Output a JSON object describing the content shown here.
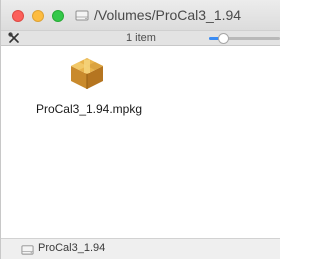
{
  "window": {
    "title": "/Volumes/ProCal3_1.94",
    "title_icon": "disk-icon"
  },
  "statusbar": {
    "tools_icon": "tools-icon",
    "item_count": "1 item",
    "zoom_slider_level": 0.15
  },
  "files": [
    {
      "name": "ProCal3_1.94.mpkg",
      "icon": "package-icon"
    }
  ],
  "pathbar": {
    "label": "ProCal3_1.94",
    "icon": "disk-icon"
  },
  "colors": {
    "close": "#fc605b",
    "minimize": "#fdbc40",
    "maximize": "#34c84a",
    "accent": "#3b8cf3"
  }
}
